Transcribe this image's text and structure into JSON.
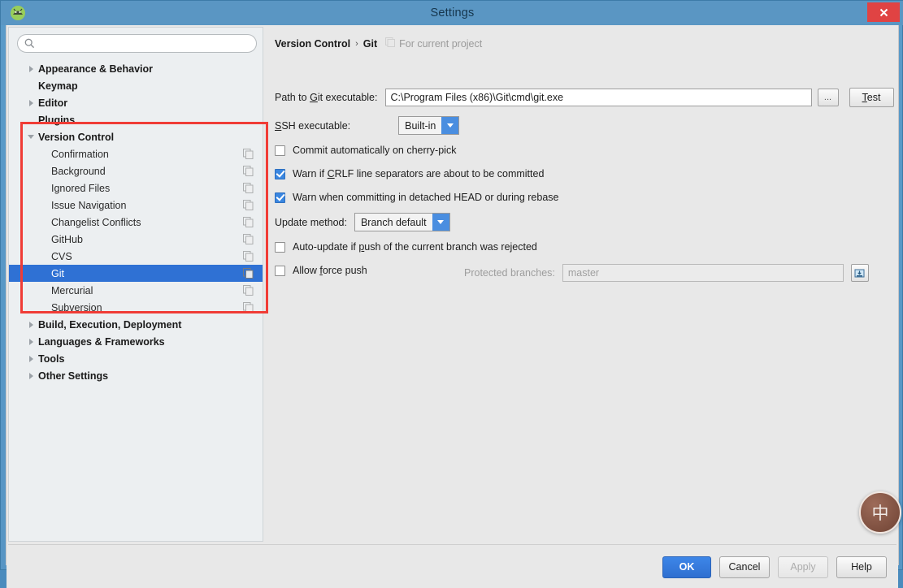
{
  "window": {
    "title": "Settings",
    "app_icon": "android-studio-icon",
    "close_label": "✕"
  },
  "sidebar": {
    "search": {
      "placeholder": "",
      "value": "",
      "icon": "search-icon"
    },
    "items": [
      {
        "label": "Appearance & Behavior",
        "level": 0,
        "arrow": "right",
        "bold": true,
        "scope_icon": false,
        "selected": false
      },
      {
        "label": "Keymap",
        "level": 0,
        "arrow": "none",
        "bold": true,
        "scope_icon": false,
        "selected": false
      },
      {
        "label": "Editor",
        "level": 0,
        "arrow": "right",
        "bold": true,
        "scope_icon": false,
        "selected": false
      },
      {
        "label": "Plugins",
        "level": 0,
        "arrow": "none",
        "bold": true,
        "scope_icon": false,
        "selected": false
      },
      {
        "label": "Version Control",
        "level": 0,
        "arrow": "down",
        "bold": true,
        "scope_icon": false,
        "selected": false
      },
      {
        "label": "Confirmation",
        "level": 1,
        "arrow": "none",
        "bold": false,
        "scope_icon": true,
        "selected": false
      },
      {
        "label": "Background",
        "level": 1,
        "arrow": "none",
        "bold": false,
        "scope_icon": true,
        "selected": false
      },
      {
        "label": "Ignored Files",
        "level": 1,
        "arrow": "none",
        "bold": false,
        "scope_icon": true,
        "selected": false
      },
      {
        "label": "Issue Navigation",
        "level": 1,
        "arrow": "none",
        "bold": false,
        "scope_icon": true,
        "selected": false
      },
      {
        "label": "Changelist Conflicts",
        "level": 1,
        "arrow": "none",
        "bold": false,
        "scope_icon": true,
        "selected": false
      },
      {
        "label": "GitHub",
        "level": 1,
        "arrow": "none",
        "bold": false,
        "scope_icon": true,
        "selected": false
      },
      {
        "label": "CVS",
        "level": 1,
        "arrow": "none",
        "bold": false,
        "scope_icon": true,
        "selected": false
      },
      {
        "label": "Git",
        "level": 1,
        "arrow": "none",
        "bold": false,
        "scope_icon": true,
        "selected": true
      },
      {
        "label": "Mercurial",
        "level": 1,
        "arrow": "none",
        "bold": false,
        "scope_icon": true,
        "selected": false
      },
      {
        "label": "Subversion",
        "level": 1,
        "arrow": "none",
        "bold": false,
        "scope_icon": true,
        "selected": false
      },
      {
        "label": "Build, Execution, Deployment",
        "level": 0,
        "arrow": "right",
        "bold": true,
        "scope_icon": false,
        "selected": false
      },
      {
        "label": "Languages & Frameworks",
        "level": 0,
        "arrow": "right",
        "bold": true,
        "scope_icon": false,
        "selected": false
      },
      {
        "label": "Tools",
        "level": 0,
        "arrow": "right",
        "bold": true,
        "scope_icon": false,
        "selected": false
      },
      {
        "label": "Other Settings",
        "level": 0,
        "arrow": "right",
        "bold": true,
        "scope_icon": false,
        "selected": false
      }
    ]
  },
  "annotation": {
    "color": "#f03c36",
    "shape": "rectangle"
  },
  "main": {
    "breadcrumb": {
      "root": "Version Control",
      "separator": "›",
      "current": "Git",
      "scope_note": "For current project",
      "scope_icon": "project-scope-icon"
    },
    "git_path": {
      "label_pre": "Path to ",
      "label_accel": "G",
      "label_post": "it executable:",
      "value": "C:\\Program Files (x86)\\Git\\cmd\\git.exe",
      "browse_label": "...",
      "test_pre": "",
      "test_accel": "T",
      "test_post": "est"
    },
    "ssh": {
      "label_accel": "S",
      "label_post": "SH executable:",
      "value": "Built-in"
    },
    "cherry_pick": {
      "label": "Commit automatically on cherry-pick",
      "checked": false
    },
    "crlf_warn": {
      "label_pre": "Warn if ",
      "label_accel": "C",
      "label_post": "RLF line separators are about to be committed",
      "checked": true
    },
    "detached_head_warn": {
      "label": "Warn when committing in detached HEAD or during rebase",
      "checked": true
    },
    "update_method": {
      "label": "Update method:",
      "value": "Branch default"
    },
    "auto_update": {
      "label_pre": "Auto-update if ",
      "label_accel": "p",
      "label_post": "ush of the current branch was rejected",
      "checked": false
    },
    "force_push": {
      "label_pre": "Allow ",
      "label_accel": "f",
      "label_post": "orce push",
      "checked": false
    },
    "protected_branches": {
      "label": "Protected branches:",
      "value": "master",
      "expand_icon": "expand-editor-icon"
    }
  },
  "footer": {
    "ok": "OK",
    "cancel": "Cancel",
    "apply": "Apply",
    "help": "Help"
  },
  "overlay": {
    "ime_badge": "中"
  },
  "colors": {
    "accent": "#2f71d4",
    "titlebar": "#5a96c3",
    "annotation": "#f03c36",
    "close": "#e04343"
  }
}
